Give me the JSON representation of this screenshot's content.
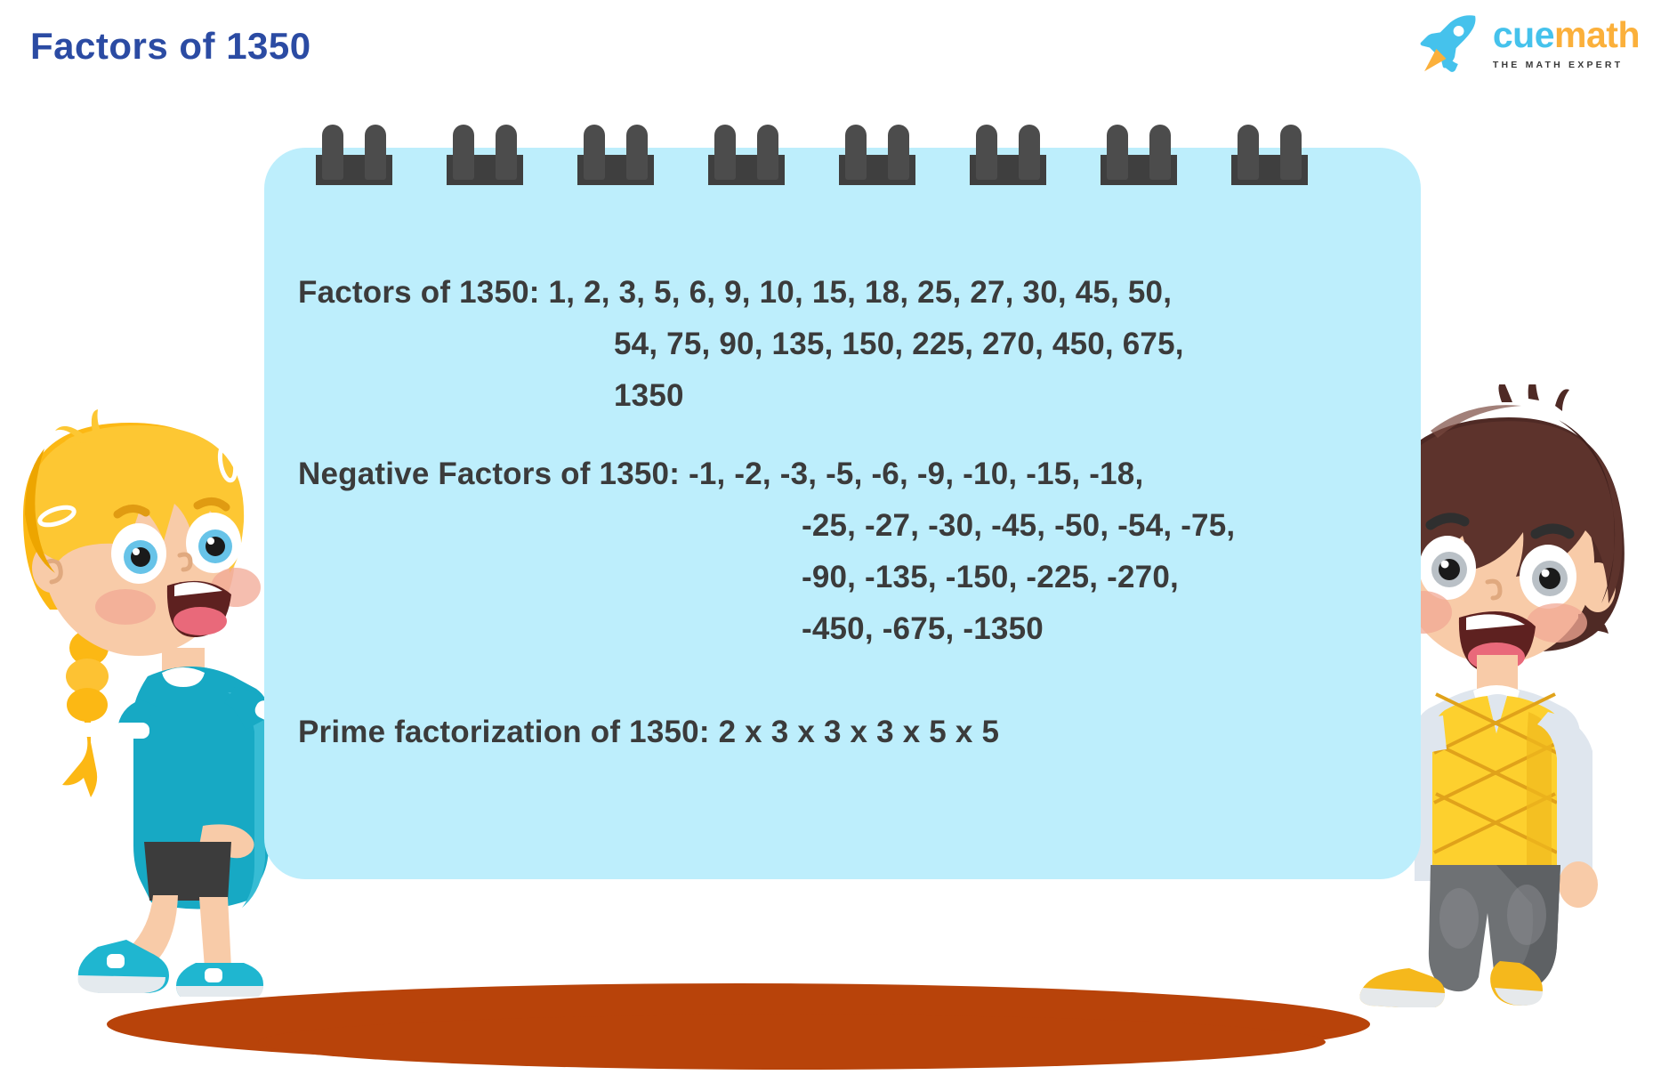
{
  "page": {
    "title": "Factors of 1350",
    "title_color": "#2b4ba3",
    "background": "#ffffff"
  },
  "logo": {
    "brand_part1": "cue",
    "brand_part2": "math",
    "tagline": "THE MATH EXPERT",
    "rocket_body_color": "#45c2ec",
    "rocket_flame_color": "#fbb03b",
    "cue_color": "#45c2ec",
    "math_color": "#fbb03b"
  },
  "board": {
    "background_color": "#bdeefc",
    "binding_color": "#4c4c4c",
    "text_color": "#3b3b3b",
    "ring_count": 8,
    "lines": [
      {
        "id": "factors-line-1",
        "indent": "none",
        "text": "Factors of 1350: 1, 2, 3, 5, 6, 9, 10, 15, 18, 25, 27, 30, 45, 50,"
      },
      {
        "id": "factors-line-2",
        "indent": "indent-a",
        "text": "54, 75, 90, 135, 150, 225, 270, 450, 675,"
      },
      {
        "id": "factors-line-3",
        "indent": "indent-a",
        "text": "1350"
      },
      {
        "id": "negative-line-1",
        "indent": "none",
        "text": "Negative Factors of 1350: -1, -2, -3, -5, -6, -9, -10, -15, -18,"
      },
      {
        "id": "negative-line-2",
        "indent": "indent-b",
        "text": "-25, -27, -30, -45, -50, -54, -75,"
      },
      {
        "id": "negative-line-3",
        "indent": "indent-b",
        "text": "-90, -135, -150, -225, -270,"
      },
      {
        "id": "negative-line-4",
        "indent": "indent-b",
        "text": "-450, -675, -1350"
      },
      {
        "id": "prime-line-1",
        "indent": "none",
        "text": "Prime factorization of 1350: 2 x 3 x 3 x 3 x 5 x 5"
      }
    ],
    "factors_label": "Factors of 1350:",
    "negative_factors_label": "Negative Factors of 1350:",
    "prime_factorization_label": "Prime factorization of 1350:",
    "factors": [
      1,
      2,
      3,
      5,
      6,
      9,
      10,
      15,
      18,
      25,
      27,
      30,
      45,
      50,
      54,
      75,
      90,
      135,
      150,
      225,
      270,
      450,
      675,
      1350
    ],
    "negative_factors": [
      -1,
      -2,
      -3,
      -5,
      -6,
      -9,
      -10,
      -15,
      -18,
      -25,
      -27,
      -30,
      -45,
      -50,
      -54,
      -75,
      -90,
      -135,
      -150,
      -225,
      -270,
      -450,
      -675,
      -1350
    ],
    "prime_factorization": "2 x 3 x 3 x 3 x 5 x 5"
  },
  "characters": {
    "girl": {
      "hair_color": "#fcb814",
      "hair_light_color": "#ffd34d",
      "skin_color": "#f8cba8",
      "dress_color": "#17a9c4",
      "leggings_color": "#3c3c3c",
      "shoes_color": "#1fb6d0"
    },
    "boy": {
      "hair_color": "#4f2a25",
      "skin_color": "#f8cba8",
      "vest_color": "#fdd02e",
      "shirt_color": "#dfe6ee",
      "pants_color": "#6e7174",
      "shoes_color": "#f5b81c"
    }
  },
  "ground": {
    "shadow_color": "#b8430a"
  }
}
